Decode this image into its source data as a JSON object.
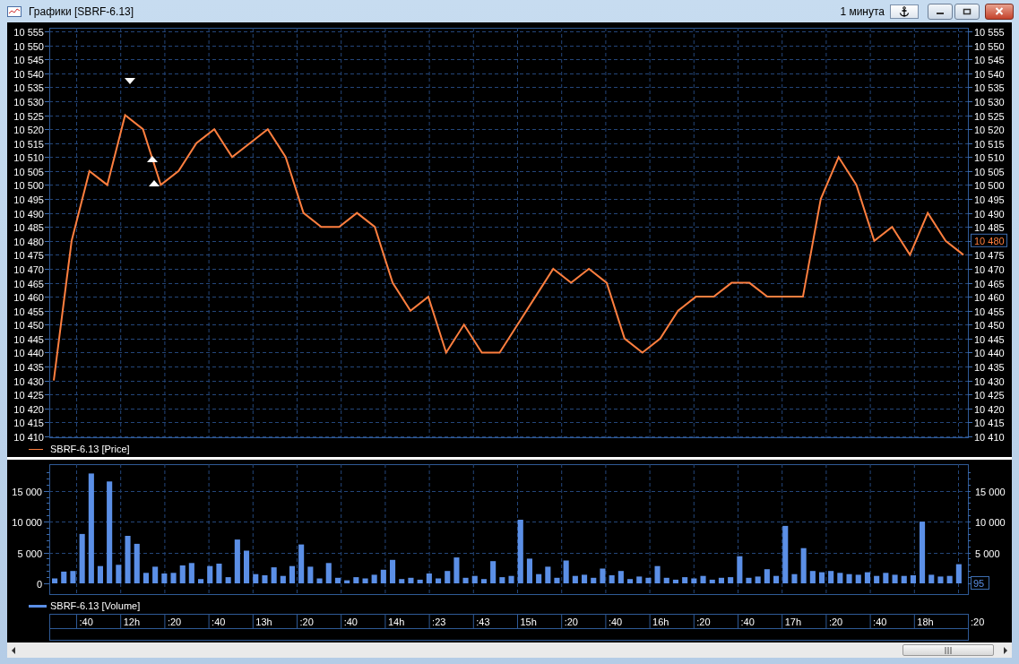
{
  "window": {
    "title": "Графики [SBRF-6.13]",
    "interval": "1 минута"
  },
  "price_panel": {
    "current_value": "10 480",
    "markers": [
      {
        "kind": "down"
      },
      {
        "kind": "up"
      },
      {
        "kind": "up"
      }
    ],
    "chart_data": {
      "type": "line",
      "grid": true,
      "ylim": [
        10410,
        10555
      ],
      "yticks": [
        {
          "value": 10555,
          "label": "10 555"
        },
        {
          "value": 10550,
          "label": "10 550"
        },
        {
          "value": 10545,
          "label": "10 545"
        },
        {
          "value": 10540,
          "label": "10 540"
        },
        {
          "value": 10535,
          "label": "10 535"
        },
        {
          "value": 10530,
          "label": "10 530"
        },
        {
          "value": 10525,
          "label": "10 525"
        },
        {
          "value": 10520,
          "label": "10 520"
        },
        {
          "value": 10515,
          "label": "10 515"
        },
        {
          "value": 10510,
          "label": "10 510"
        },
        {
          "value": 10505,
          "label": "10 505"
        },
        {
          "value": 10500,
          "label": "10 500"
        },
        {
          "value": 10495,
          "label": "10 495"
        },
        {
          "value": 10490,
          "label": "10 490"
        },
        {
          "value": 10485,
          "label": "10 485"
        },
        {
          "value": 10480,
          "label": "10 480"
        },
        {
          "value": 10475,
          "label": "10 475"
        },
        {
          "value": 10470,
          "label": "10 470"
        },
        {
          "value": 10465,
          "label": "10 465"
        },
        {
          "value": 10460,
          "label": "10 460"
        },
        {
          "value": 10455,
          "label": "10 455"
        },
        {
          "value": 10450,
          "label": "10 450"
        },
        {
          "value": 10445,
          "label": "10 445"
        },
        {
          "value": 10440,
          "label": "10 440"
        },
        {
          "value": 10435,
          "label": "10 435"
        },
        {
          "value": 10430,
          "label": "10 430"
        },
        {
          "value": 10425,
          "label": "10 425"
        },
        {
          "value": 10420,
          "label": "10 420"
        },
        {
          "value": 10415,
          "label": "10 415"
        },
        {
          "value": 10410,
          "label": "10 410"
        }
      ],
      "series": [
        {
          "name": "SBRF-6.13 [Price]",
          "color": "#ff7f3f",
          "values": [
            10430,
            10480,
            10505,
            10500,
            10525,
            10520,
            10500,
            10505,
            10515,
            10520,
            10510,
            10515,
            10520,
            10510,
            10490,
            10485,
            10485,
            10490,
            10485,
            10465,
            10455,
            10460,
            10440,
            10450,
            10440,
            10440,
            10450,
            10460,
            10470,
            10465,
            10470,
            10465,
            10445,
            10440,
            10445,
            10455,
            10460,
            10460,
            10465,
            10465,
            10460,
            10460,
            10460,
            10495,
            10510,
            10500,
            10480,
            10485,
            10475,
            10490,
            10480,
            10475
          ]
        }
      ]
    },
    "right_axis_labels": [
      "10 555",
      "10 550",
      "10 545",
      "10 540",
      "10 535",
      "10 530",
      "10 525",
      "10 520",
      "10 515",
      "10 510",
      "10 505",
      "10 500",
      "10 495",
      "10 490",
      "10 485",
      "10 475",
      "10 470",
      "10 465",
      "10 460",
      "10 455",
      "10 450",
      "10 445",
      "10 440",
      "10 435",
      "10 430",
      "10 425",
      "10 420",
      "10 415",
      "10 410"
    ]
  },
  "volume_panel": {
    "current_value": "95",
    "chart_data": {
      "type": "bar",
      "grid": true,
      "ylim": [
        0,
        18000
      ],
      "yticks": [
        {
          "value": 0,
          "label": "0"
        },
        {
          "value": 5000,
          "label": "5 000"
        },
        {
          "value": 10000,
          "label": "10 000"
        },
        {
          "value": 15000,
          "label": "15 000"
        }
      ],
      "series": [
        {
          "name": "SBRF-6.13 [Volume]",
          "color": "#5b8fe6",
          "values": [
            800,
            1900,
            2000,
            8000,
            17800,
            2800,
            16500,
            3000,
            7700,
            6400,
            1700,
            2700,
            1600,
            1700,
            2900,
            3300,
            700,
            2800,
            3200,
            1000,
            7100,
            5300,
            1500,
            1300,
            2600,
            1200,
            2800,
            6300,
            2700,
            800,
            3300,
            900,
            500,
            1000,
            800,
            1400,
            2200,
            3800,
            700,
            900,
            600,
            1600,
            800,
            2000,
            4200,
            900,
            1200,
            700,
            3600,
            1000,
            1200,
            10300,
            4000,
            1500,
            2700,
            900,
            3700,
            1200,
            1400,
            900,
            2400,
            1300,
            2000,
            700,
            1100,
            900,
            2800,
            900,
            600,
            1000,
            800,
            1200,
            600,
            900,
            1000,
            4400,
            900,
            1100,
            2300,
            1200,
            9300,
            1500,
            5700,
            2000,
            1800,
            2000,
            1700,
            1500,
            1400,
            1800,
            1200,
            1700,
            1400,
            1200,
            1300,
            10000,
            1400,
            1100,
            1200,
            3100
          ]
        }
      ]
    },
    "right_axis_labels": [
      "15 000",
      "10 000",
      "5 000"
    ]
  },
  "time_axis": [
    ":40",
    "12h",
    ":20",
    ":40",
    "13h",
    ":20",
    ":40",
    "14h",
    ":23",
    ":43",
    "15h",
    ":20",
    ":40",
    "16h",
    ":20",
    ":40",
    "17h",
    ":20",
    ":40",
    "18h",
    ":20"
  ]
}
